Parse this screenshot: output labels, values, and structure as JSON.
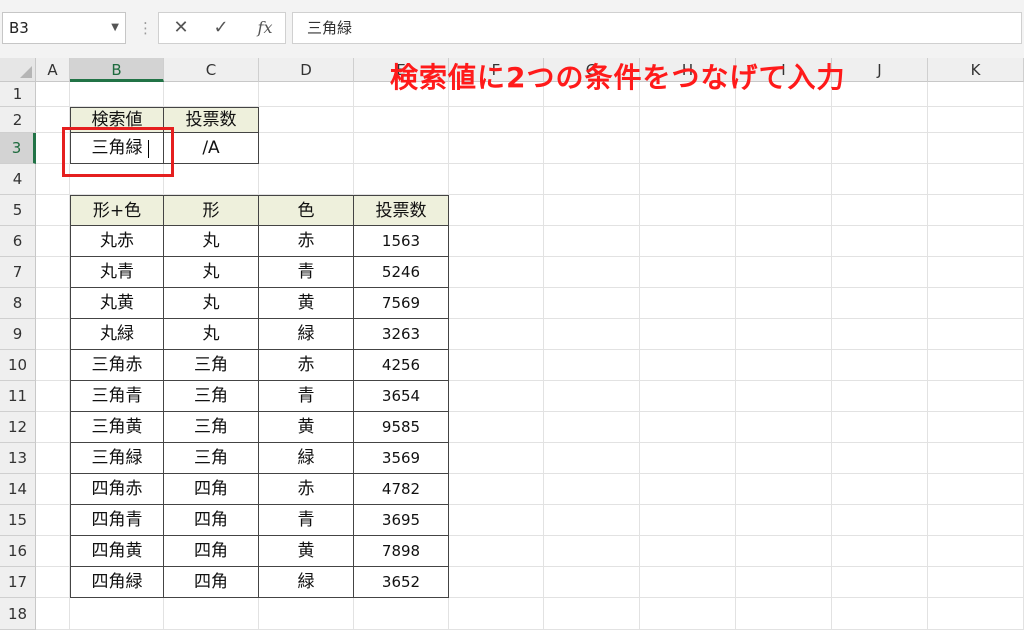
{
  "formula_bar": {
    "name_box": "B3",
    "cancel_icon": "✕",
    "enter_icon": "✓",
    "fx_label": "fx",
    "formula": "三角緑"
  },
  "columns": [
    "A",
    "B",
    "C",
    "D",
    "E",
    "F",
    "G",
    "H",
    "I",
    "J",
    "K"
  ],
  "selected_column": "B",
  "rows": [
    "1",
    "2",
    "3",
    "4",
    "5",
    "6",
    "7",
    "8",
    "9",
    "10",
    "11",
    "12",
    "13",
    "14",
    "15",
    "16",
    "17",
    "18"
  ],
  "selected_row": "3",
  "lookup_table": {
    "header": [
      "検索値",
      "投票数"
    ],
    "row": [
      "三角緑",
      "/A"
    ]
  },
  "data_table": {
    "header": [
      "形+色",
      "形",
      "色",
      "投票数"
    ],
    "rows": [
      [
        "丸赤",
        "丸",
        "赤",
        "1563"
      ],
      [
        "丸青",
        "丸",
        "青",
        "5246"
      ],
      [
        "丸黄",
        "丸",
        "黄",
        "7569"
      ],
      [
        "丸緑",
        "丸",
        "緑",
        "3263"
      ],
      [
        "三角赤",
        "三角",
        "赤",
        "4256"
      ],
      [
        "三角青",
        "三角",
        "青",
        "3654"
      ],
      [
        "三角黄",
        "三角",
        "黄",
        "9585"
      ],
      [
        "三角緑",
        "三角",
        "緑",
        "3569"
      ],
      [
        "四角赤",
        "四角",
        "赤",
        "4782"
      ],
      [
        "四角青",
        "四角",
        "青",
        "3695"
      ],
      [
        "四角黄",
        "四角",
        "黄",
        "7898"
      ],
      [
        "四角緑",
        "四角",
        "緑",
        "3652"
      ]
    ]
  },
  "annotation": "検索値に2つの条件をつなげて入力",
  "colors": {
    "annotation": "#ff1a1a",
    "selection_green": "#217346",
    "header_fill": "#eef0dc"
  }
}
